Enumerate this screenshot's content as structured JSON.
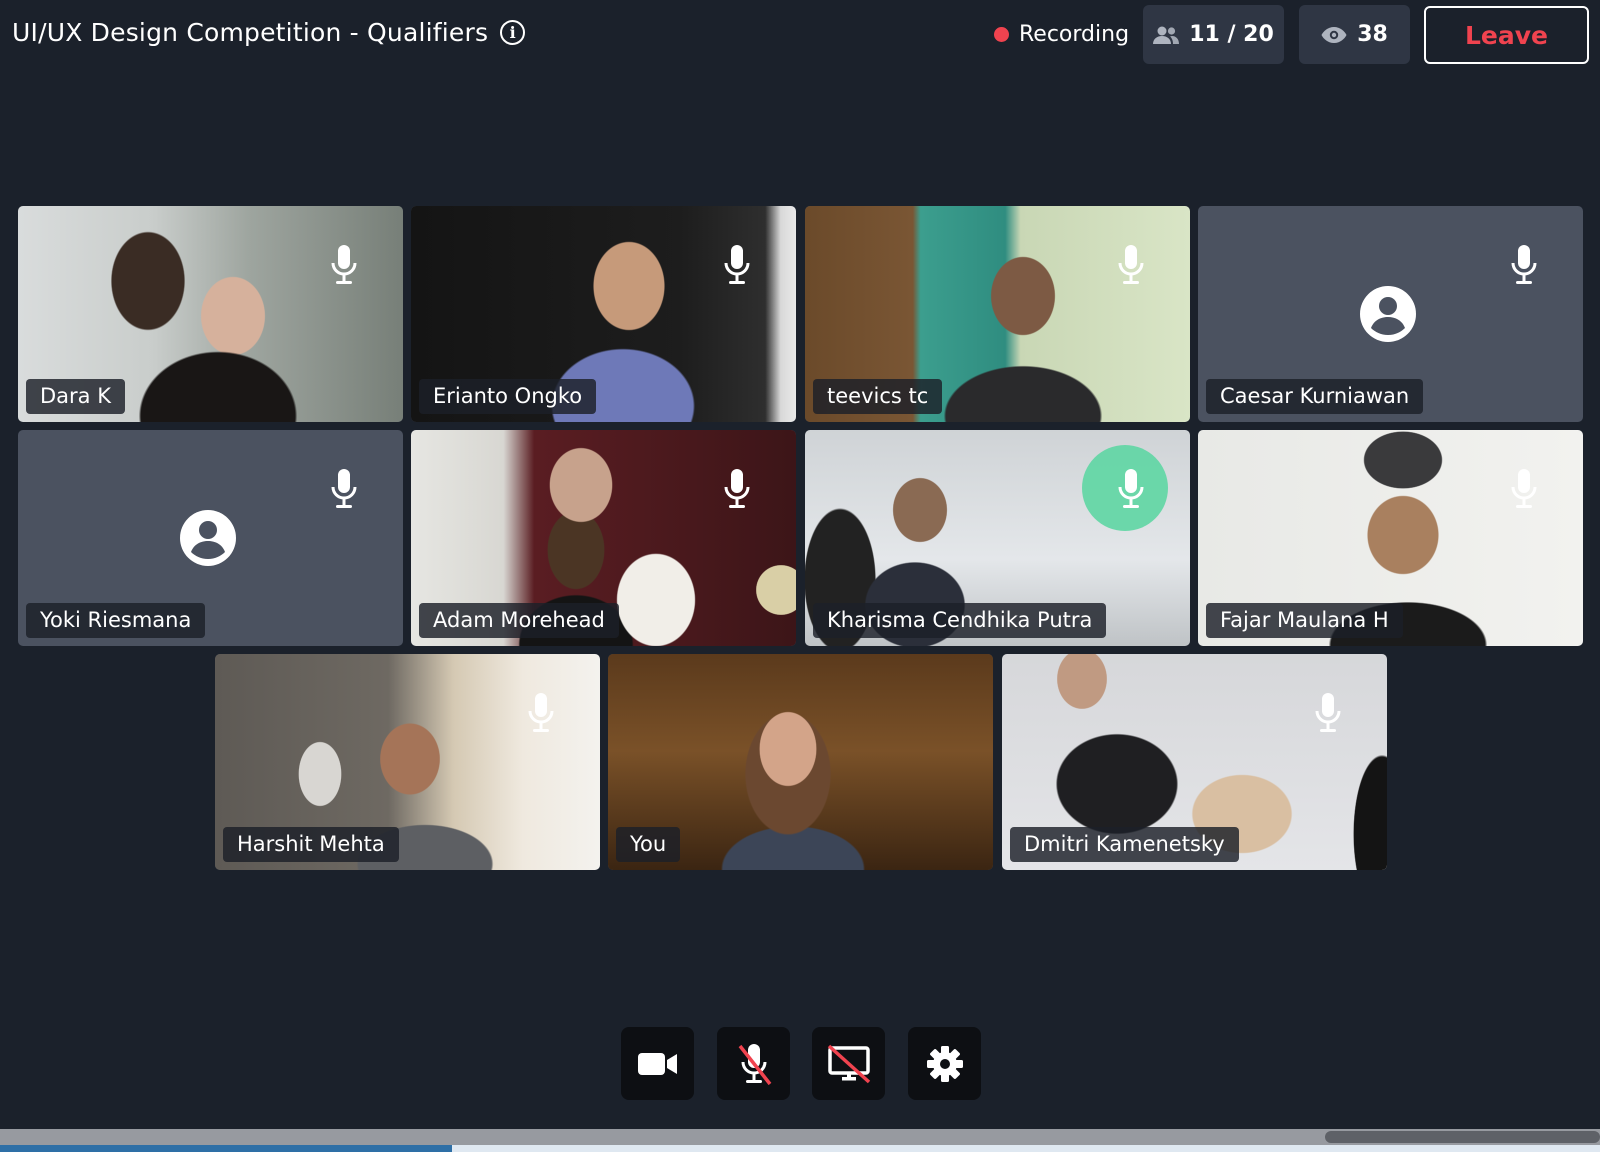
{
  "meeting": {
    "title": "UI/UX Design Competition - Qualifiers",
    "recording_label": "Recording",
    "participants": "11 / 20",
    "viewers": "38",
    "leave_label": "Leave"
  },
  "participants": [
    {
      "name": "Dara K",
      "video": true,
      "speaking": false
    },
    {
      "name": "Erianto Ongko",
      "video": true,
      "speaking": false
    },
    {
      "name": "teevics tc",
      "video": true,
      "speaking": false
    },
    {
      "name": "Caesar Kurniawan",
      "video": false,
      "speaking": false
    },
    {
      "name": "Yoki Riesmana",
      "video": false,
      "speaking": false
    },
    {
      "name": "Adam Morehead",
      "video": true,
      "speaking": false
    },
    {
      "name": "Kharisma Cendhika Putra",
      "video": true,
      "speaking": true
    },
    {
      "name": "Fajar Maulana H",
      "video": true,
      "speaking": false
    },
    {
      "name": "Harshit Mehta",
      "video": true,
      "speaking": false
    },
    {
      "name": "You",
      "video": true,
      "speaking": false
    },
    {
      "name": "Dmitri Kamenetsky",
      "video": true,
      "speaking": false
    }
  ],
  "controls": [
    {
      "name": "camera-toggle-button",
      "icon": "video-camera-icon",
      "state": "on"
    },
    {
      "name": "mic-toggle-button",
      "icon": "microphone-off-icon",
      "state": "off"
    },
    {
      "name": "screen-share-button",
      "icon": "screen-share-off-icon",
      "state": "off"
    },
    {
      "name": "settings-button",
      "icon": "gear-icon"
    }
  ],
  "colors": {
    "background": "#1b212b",
    "recording_dot": "#f0434f",
    "leave_text": "#f0434f",
    "speaking_ring": "#5ed6a3",
    "no_video_tile": "#4b5260"
  }
}
